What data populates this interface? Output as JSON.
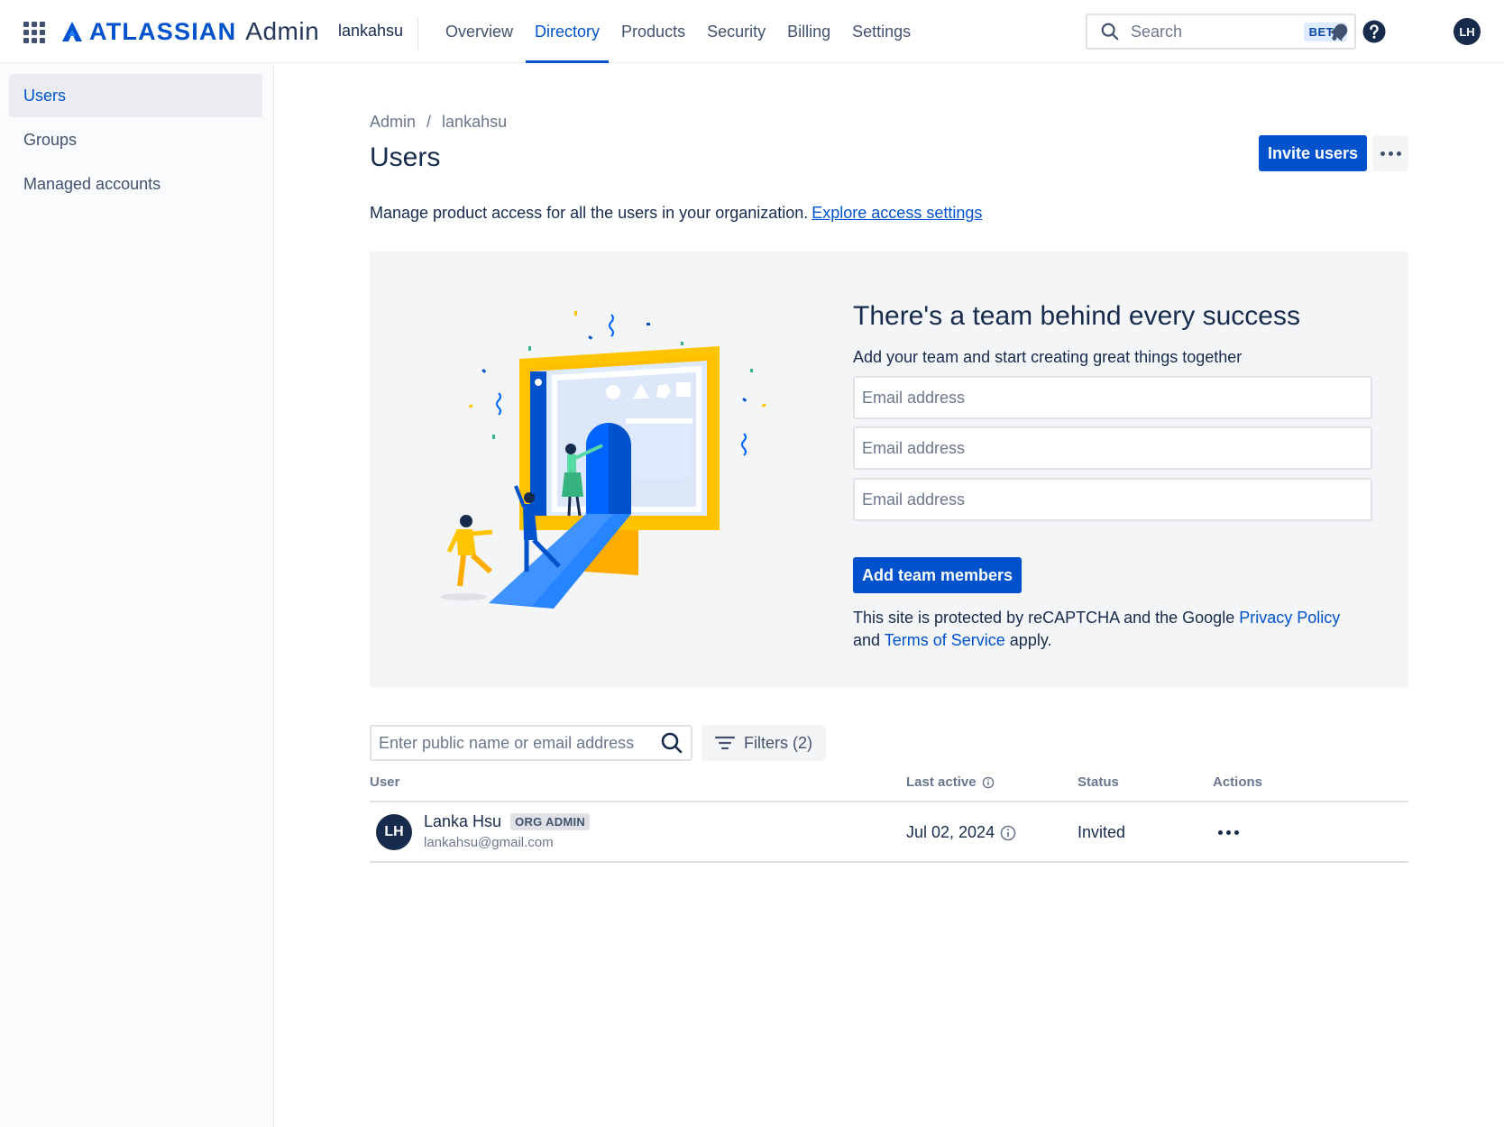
{
  "header": {
    "logo_word": "ATLASSIAN",
    "product": "Admin",
    "org_name": "lankahsu",
    "nav": [
      {
        "label": "Overview"
      },
      {
        "label": "Directory"
      },
      {
        "label": "Products"
      },
      {
        "label": "Security"
      },
      {
        "label": "Billing"
      },
      {
        "label": "Settings"
      }
    ],
    "active_nav": "Directory",
    "search_placeholder": "Search",
    "search_badge": "BETA",
    "avatar_initials": "LH"
  },
  "sidebar": {
    "items": [
      {
        "label": "Users"
      },
      {
        "label": "Groups"
      },
      {
        "label": "Managed accounts"
      }
    ],
    "active": "Users"
  },
  "main": {
    "breadcrumb": [
      "Admin",
      "lankahsu"
    ],
    "breadcrumb_separator": "/",
    "title": "Users",
    "invite_label": "Invite users",
    "intro_text": "Manage product access for all the users in your organization.",
    "intro_link": "Explore access settings"
  },
  "panel": {
    "title": "There's a team behind every success",
    "subtitle": "Add your team and start creating great things together",
    "email_placeholder": "Email address",
    "add_button": "Add team members",
    "recaptcha_pre": "This site is protected by reCAPTCHA and the Google",
    "privacy_link": "Privacy Policy",
    "recaptcha_and": "and",
    "terms_link": "Terms of Service",
    "recaptcha_post": "apply."
  },
  "table": {
    "search_placeholder": "Enter public name or email address",
    "filters_label": "Filters (2)",
    "columns": {
      "user": "User",
      "last_active": "Last active",
      "status": "Status",
      "actions": "Actions"
    },
    "rows": [
      {
        "initials": "LH",
        "name": "Lanka Hsu",
        "badge": "ORG ADMIN",
        "email": "lankahsu@gmail.com",
        "last_active": "Jul 02, 2024",
        "status": "Invited"
      }
    ]
  },
  "colors": {
    "brand_blue": "#0052cc",
    "text_dark": "#172b4d",
    "text_subtle": "#6b778c",
    "panel_bg": "#f4f5f7",
    "illustration_yellow": "#ffc400",
    "illustration_orange": "#ffab00",
    "illustration_green": "#36b37e"
  },
  "icons": {
    "apps": "app-switcher-icon",
    "search": "search-icon",
    "notifications": "notification-bell-icon",
    "help": "help-icon",
    "filter": "filter-icon",
    "info": "info-icon",
    "more": "more-icon"
  }
}
